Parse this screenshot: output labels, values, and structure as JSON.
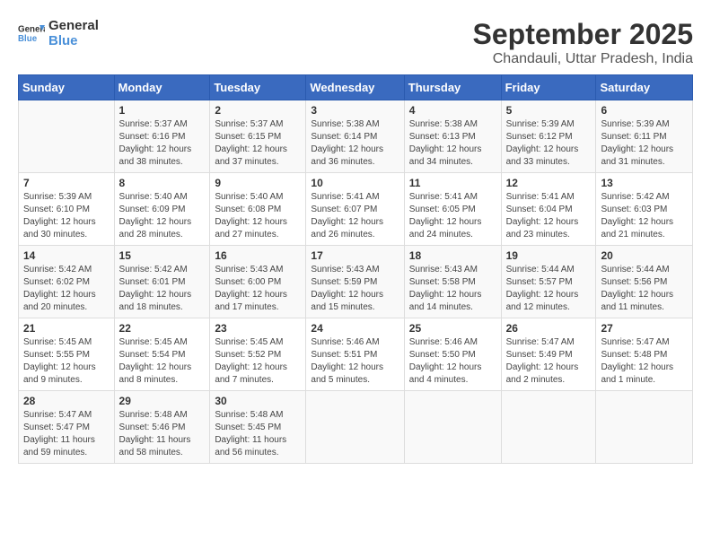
{
  "logo": {
    "text_general": "General",
    "text_blue": "Blue"
  },
  "title": "September 2025",
  "location": "Chandauli, Uttar Pradesh, India",
  "days_of_week": [
    "Sunday",
    "Monday",
    "Tuesday",
    "Wednesday",
    "Thursday",
    "Friday",
    "Saturday"
  ],
  "weeks": [
    [
      {
        "day": "",
        "info": ""
      },
      {
        "day": "1",
        "info": "Sunrise: 5:37 AM\nSunset: 6:16 PM\nDaylight: 12 hours\nand 38 minutes."
      },
      {
        "day": "2",
        "info": "Sunrise: 5:37 AM\nSunset: 6:15 PM\nDaylight: 12 hours\nand 37 minutes."
      },
      {
        "day": "3",
        "info": "Sunrise: 5:38 AM\nSunset: 6:14 PM\nDaylight: 12 hours\nand 36 minutes."
      },
      {
        "day": "4",
        "info": "Sunrise: 5:38 AM\nSunset: 6:13 PM\nDaylight: 12 hours\nand 34 minutes."
      },
      {
        "day": "5",
        "info": "Sunrise: 5:39 AM\nSunset: 6:12 PM\nDaylight: 12 hours\nand 33 minutes."
      },
      {
        "day": "6",
        "info": "Sunrise: 5:39 AM\nSunset: 6:11 PM\nDaylight: 12 hours\nand 31 minutes."
      }
    ],
    [
      {
        "day": "7",
        "info": "Sunrise: 5:39 AM\nSunset: 6:10 PM\nDaylight: 12 hours\nand 30 minutes."
      },
      {
        "day": "8",
        "info": "Sunrise: 5:40 AM\nSunset: 6:09 PM\nDaylight: 12 hours\nand 28 minutes."
      },
      {
        "day": "9",
        "info": "Sunrise: 5:40 AM\nSunset: 6:08 PM\nDaylight: 12 hours\nand 27 minutes."
      },
      {
        "day": "10",
        "info": "Sunrise: 5:41 AM\nSunset: 6:07 PM\nDaylight: 12 hours\nand 26 minutes."
      },
      {
        "day": "11",
        "info": "Sunrise: 5:41 AM\nSunset: 6:05 PM\nDaylight: 12 hours\nand 24 minutes."
      },
      {
        "day": "12",
        "info": "Sunrise: 5:41 AM\nSunset: 6:04 PM\nDaylight: 12 hours\nand 23 minutes."
      },
      {
        "day": "13",
        "info": "Sunrise: 5:42 AM\nSunset: 6:03 PM\nDaylight: 12 hours\nand 21 minutes."
      }
    ],
    [
      {
        "day": "14",
        "info": "Sunrise: 5:42 AM\nSunset: 6:02 PM\nDaylight: 12 hours\nand 20 minutes."
      },
      {
        "day": "15",
        "info": "Sunrise: 5:42 AM\nSunset: 6:01 PM\nDaylight: 12 hours\nand 18 minutes."
      },
      {
        "day": "16",
        "info": "Sunrise: 5:43 AM\nSunset: 6:00 PM\nDaylight: 12 hours\nand 17 minutes."
      },
      {
        "day": "17",
        "info": "Sunrise: 5:43 AM\nSunset: 5:59 PM\nDaylight: 12 hours\nand 15 minutes."
      },
      {
        "day": "18",
        "info": "Sunrise: 5:43 AM\nSunset: 5:58 PM\nDaylight: 12 hours\nand 14 minutes."
      },
      {
        "day": "19",
        "info": "Sunrise: 5:44 AM\nSunset: 5:57 PM\nDaylight: 12 hours\nand 12 minutes."
      },
      {
        "day": "20",
        "info": "Sunrise: 5:44 AM\nSunset: 5:56 PM\nDaylight: 12 hours\nand 11 minutes."
      }
    ],
    [
      {
        "day": "21",
        "info": "Sunrise: 5:45 AM\nSunset: 5:55 PM\nDaylight: 12 hours\nand 9 minutes."
      },
      {
        "day": "22",
        "info": "Sunrise: 5:45 AM\nSunset: 5:54 PM\nDaylight: 12 hours\nand 8 minutes."
      },
      {
        "day": "23",
        "info": "Sunrise: 5:45 AM\nSunset: 5:52 PM\nDaylight: 12 hours\nand 7 minutes."
      },
      {
        "day": "24",
        "info": "Sunrise: 5:46 AM\nSunset: 5:51 PM\nDaylight: 12 hours\nand 5 minutes."
      },
      {
        "day": "25",
        "info": "Sunrise: 5:46 AM\nSunset: 5:50 PM\nDaylight: 12 hours\nand 4 minutes."
      },
      {
        "day": "26",
        "info": "Sunrise: 5:47 AM\nSunset: 5:49 PM\nDaylight: 12 hours\nand 2 minutes."
      },
      {
        "day": "27",
        "info": "Sunrise: 5:47 AM\nSunset: 5:48 PM\nDaylight: 12 hours\nand 1 minute."
      }
    ],
    [
      {
        "day": "28",
        "info": "Sunrise: 5:47 AM\nSunset: 5:47 PM\nDaylight: 11 hours\nand 59 minutes."
      },
      {
        "day": "29",
        "info": "Sunrise: 5:48 AM\nSunset: 5:46 PM\nDaylight: 11 hours\nand 58 minutes."
      },
      {
        "day": "30",
        "info": "Sunrise: 5:48 AM\nSunset: 5:45 PM\nDaylight: 11 hours\nand 56 minutes."
      },
      {
        "day": "",
        "info": ""
      },
      {
        "day": "",
        "info": ""
      },
      {
        "day": "",
        "info": ""
      },
      {
        "day": "",
        "info": ""
      }
    ]
  ]
}
